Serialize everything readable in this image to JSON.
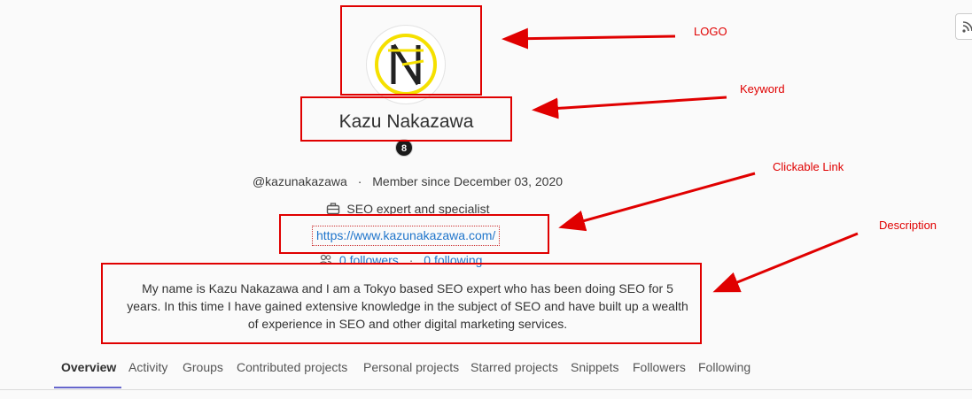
{
  "profile": {
    "name": "Kazu Nakazawa",
    "badge": "8",
    "username": "@kazunakazawa",
    "member_since": "Member since December 03, 2020",
    "job_title": "SEO expert and specialist",
    "website": "https://www.kazunakazawa.com/",
    "followers": "0 followers",
    "following": "0 following",
    "description": "My name is Kazu Nakazawa and I am a Tokyo based SEO expert who has been doing SEO for 5 years. In this time I have gained extensive knowledge in the subject of SEO and have built up a wealth of experience in SEO and other digital marketing services.",
    "dot": "·",
    "avatar_logo_letter": "N"
  },
  "annotations": {
    "logo": "LOGO",
    "keyword": "Keyword",
    "link": "Clickable Link",
    "description": "Description"
  },
  "tabs": [
    {
      "label": "Overview",
      "active": true
    },
    {
      "label": "Activity"
    },
    {
      "label": "Groups"
    },
    {
      "label": "Contributed projects"
    },
    {
      "label": "Personal projects"
    },
    {
      "label": "Starred projects"
    },
    {
      "label": "Snippets"
    },
    {
      "label": "Followers"
    },
    {
      "label": "Following"
    }
  ],
  "colors": {
    "annotation_red": "#e00000",
    "link_blue": "#1f75cb",
    "logo_yellow": "#f5e000",
    "active_tab_underline": "#6666cc"
  },
  "icons": {
    "feed": "rss-icon",
    "job": "briefcase-icon",
    "followers": "users-icon"
  }
}
